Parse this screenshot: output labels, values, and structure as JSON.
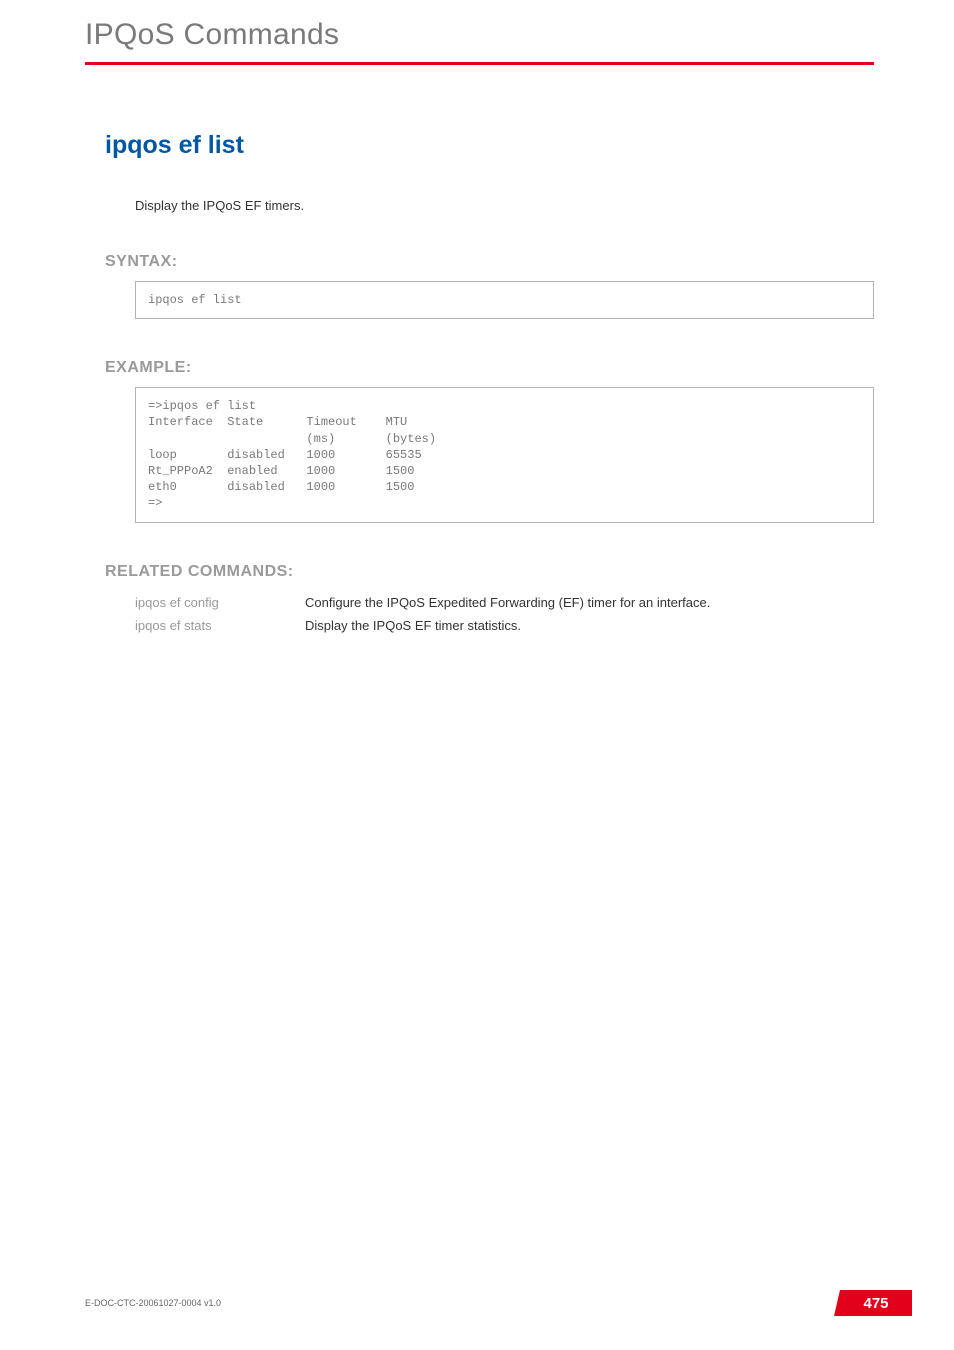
{
  "chapter": {
    "title": "IPQoS Commands"
  },
  "command": {
    "title": "ipqos ef list",
    "description": "Display the IPQoS EF timers."
  },
  "syntax": {
    "label": "SYNTAX:",
    "code": "ipqos ef list"
  },
  "example": {
    "label": "EXAMPLE:",
    "code": "=>ipqos ef list\nInterface  State      Timeout    MTU\n                      (ms)       (bytes)\nloop       disabled   1000       65535\nRt_PPPoA2  enabled    1000       1500\neth0       disabled   1000       1500\n=>"
  },
  "related": {
    "label": "RELATED COMMANDS:",
    "items": [
      {
        "cmd": "ipqos ef config",
        "desc": "Configure the IPQoS Expedited Forwarding (EF) timer for an interface."
      },
      {
        "cmd": "ipqos ef stats",
        "desc": "Display the IPQoS EF timer statistics."
      }
    ]
  },
  "footer": {
    "doc": "E-DOC-CTC-20061027-0004 v1.0",
    "page": "475"
  },
  "chart_data": {
    "type": "table",
    "title": "ipqos ef list output",
    "columns": [
      "Interface",
      "State",
      "Timeout (ms)",
      "MTU (bytes)"
    ],
    "rows": [
      [
        "loop",
        "disabled",
        1000,
        65535
      ],
      [
        "Rt_PPPoA2",
        "enabled",
        1000,
        1500
      ],
      [
        "eth0",
        "disabled",
        1000,
        1500
      ]
    ]
  }
}
